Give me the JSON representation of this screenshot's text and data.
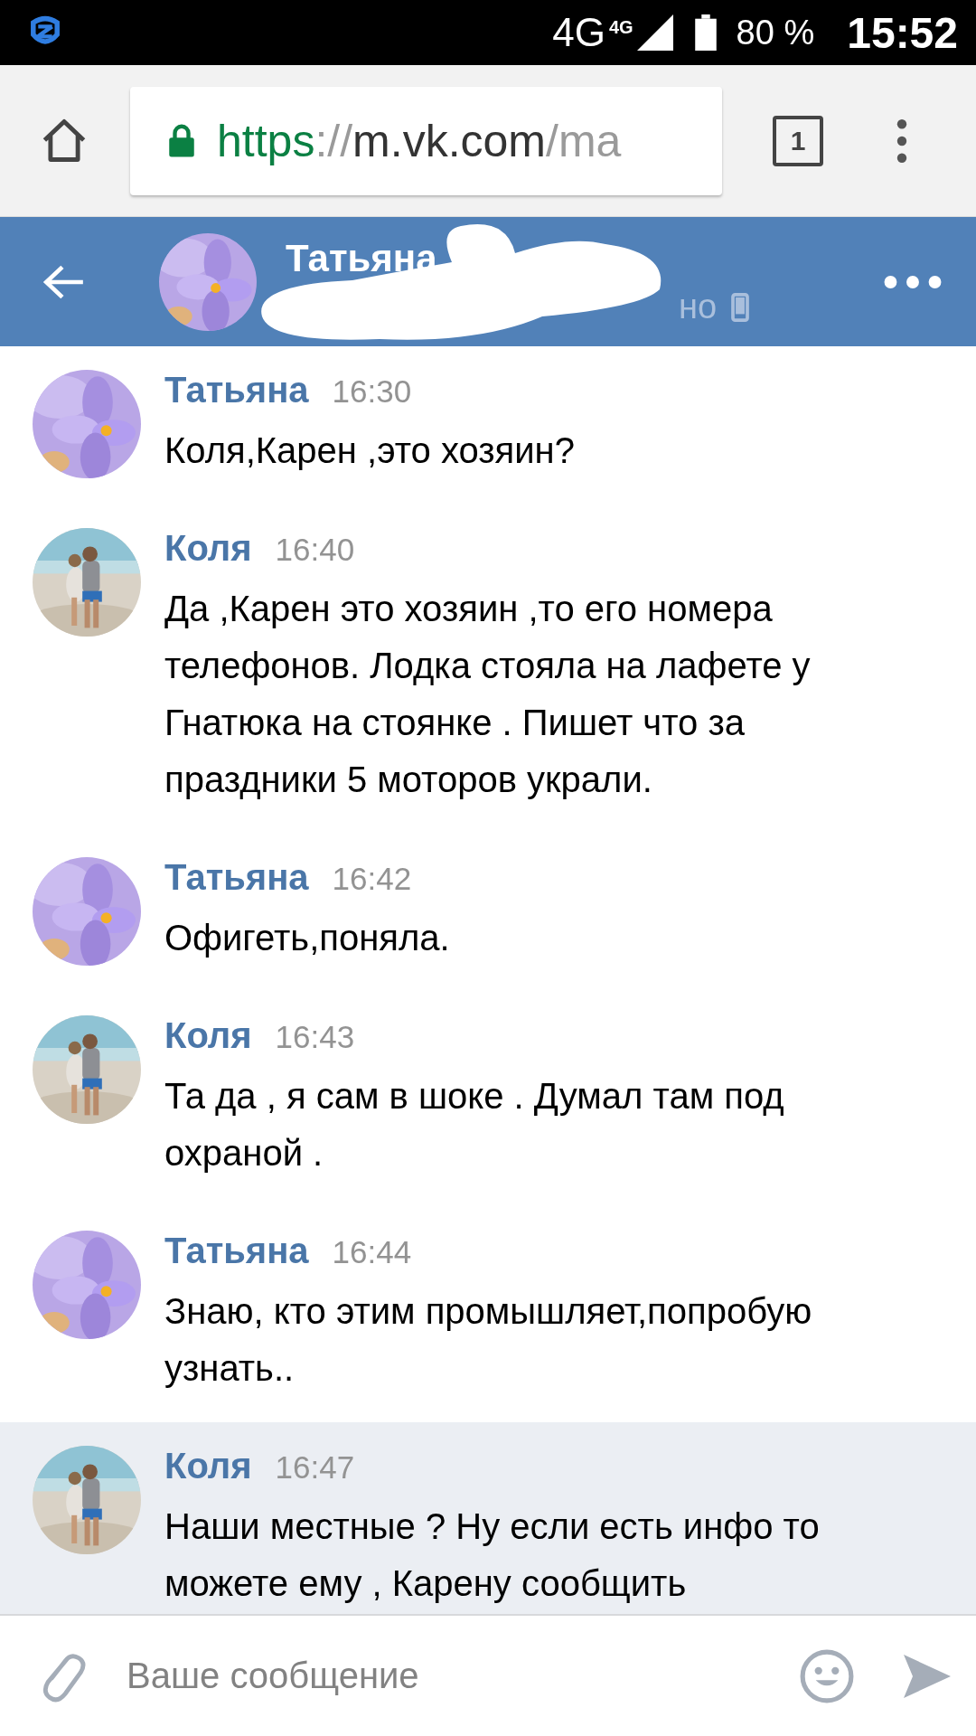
{
  "status_bar": {
    "network": "4G",
    "network_small": "4G",
    "battery": "80 %",
    "time": "15:52"
  },
  "browser": {
    "url_parts": [
      {
        "text": "https",
        "kind": "scheme"
      },
      {
        "text": "://",
        "kind": "muted"
      },
      {
        "text": "m.vk.com",
        "kind": "host"
      },
      {
        "text": "/ma",
        "kind": "muted"
      }
    ],
    "tab_count": "1"
  },
  "header": {
    "title": "Татьяна",
    "subtitle": "но"
  },
  "messages": [
    {
      "sender": "Татьяна",
      "time": "16:30",
      "text": "Коля,Карен ,это хозяин?",
      "highlighted": false
    },
    {
      "sender": "Коля",
      "time": "16:40",
      "text": "Да ,Карен это хозяин ,то его номера телефонов. Лодка стояла на лафете у Гнатюка на стоянке . Пишет что за праздники 5 моторов украли.",
      "highlighted": false
    },
    {
      "sender": "Татьяна",
      "time": "16:42",
      "text": "Офигеть,поняла.",
      "highlighted": false
    },
    {
      "sender": "Коля",
      "time": "16:43",
      "text": "Та да , я сам в шоке . Думал там под охраной .",
      "highlighted": false
    },
    {
      "sender": "Татьяна",
      "time": "16:44",
      "text": "Знаю, кто этим промышляет,попробую узнать..",
      "highlighted": false
    },
    {
      "sender": "Коля",
      "time": "16:47",
      "text": "Наши местные ? Ну если есть инфо то можете ему , Карену сообщить",
      "highlighted": true
    }
  ],
  "composer": {
    "placeholder": "Ваше сообщение"
  }
}
